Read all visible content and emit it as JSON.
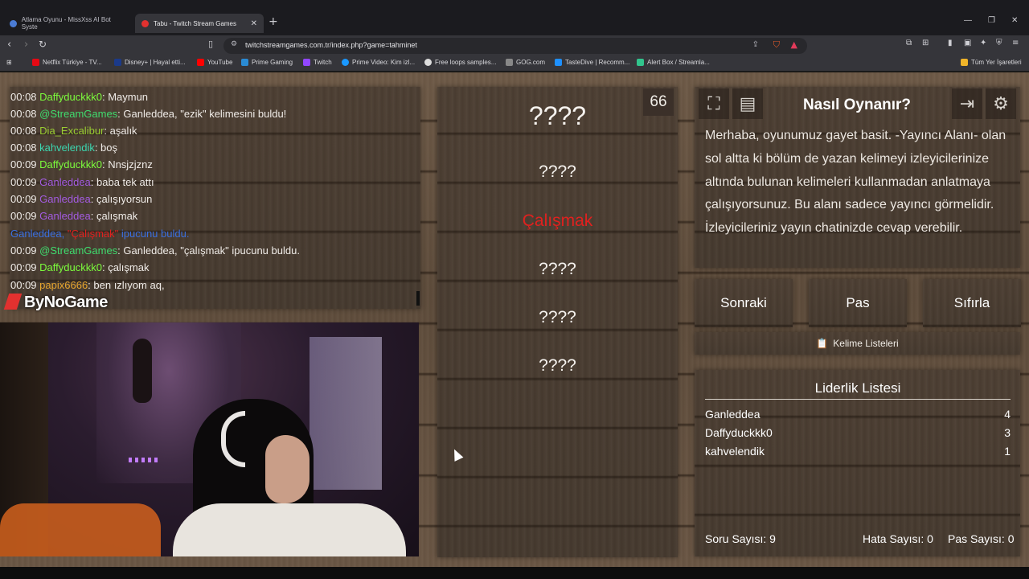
{
  "browser": {
    "tabs": [
      {
        "label": "Atlama Oyunu - MissXss AI Bot Syste",
        "active": false
      },
      {
        "label": "Tabu - Twitch Stream Games",
        "active": true
      }
    ],
    "url": "twitchstreamgames.com.tr/index.php?game=tahminet",
    "bookmarks": [
      "Netflix Türkiye - TV...",
      "Disney+ | Hayal etti...",
      "YouTube",
      "Prime Gaming",
      "Twitch",
      "Prime Video: Kim izl...",
      "Free loops samples...",
      "GOG.com",
      "TasteDive | Recomm...",
      "Alert Box / Streamla..."
    ],
    "bookmarks_other": "Tüm Yer İşaretleri"
  },
  "chat": {
    "lines": [
      {
        "time": "00:08",
        "user": "Daffyduckkk0",
        "user_color": "#7cfc3c",
        "text": ": Maymun"
      },
      {
        "time": "00:08",
        "user": "@StreamGames",
        "user_color": "#3fdc6e",
        "text": ": Ganleddea, \"ezik\" kelimesini buldu!"
      },
      {
        "time": "00:08",
        "user": "Dia_Excalibur",
        "user_color": "#9acd32",
        "text": ": aşalık"
      },
      {
        "time": "00:08",
        "user": "kahvelendik",
        "user_color": "#3cd6b0",
        "text": ": boş"
      },
      {
        "time": "00:09",
        "user": "Daffyduckkk0",
        "user_color": "#7cfc3c",
        "text": ": Nnsjzjznz"
      },
      {
        "time": "00:09",
        "user": "Ganleddea",
        "user_color": "#a35be0",
        "text": ": baba tek attı"
      },
      {
        "time": "00:09",
        "user": "Ganleddea",
        "user_color": "#a35be0",
        "text": ": çalışıyorsun"
      },
      {
        "time": "00:09",
        "user": "Ganleddea",
        "user_color": "#a35be0",
        "text": ": çalışmak"
      },
      {
        "time": "00:09",
        "user": "@StreamGames",
        "user_color": "#3fdc6e",
        "text": ": Ganleddea, \"çalışmak\" ipucunu buldu."
      },
      {
        "time": "00:09",
        "user": "Daffyduckkk0",
        "user_color": "#7cfc3c",
        "text": ": çalışmak"
      },
      {
        "time": "00:09",
        "user": "papix6666",
        "user_color": "#e6a52e",
        "text": ": ben ızlıyom aq,"
      }
    ],
    "system_line": {
      "user": "Ganleddea, ",
      "word": "\"Çalışmak\"",
      "rest": " ipucunu buldu."
    }
  },
  "logo": "ByNoGame",
  "game": {
    "timer": "66",
    "main_word": "????",
    "hints": [
      "????",
      "Çalışmak",
      "????",
      "????",
      "????"
    ],
    "found_color": "#e0211f"
  },
  "howto": {
    "title": "Nasıl Oynanır?",
    "text": "Merhaba, oyunumuz gayet basit. -Yayıncı Alanı- olan sol altta ki bölüm de yazan kelimeyi izleyicilerinize altında bulunan kelimeleri kullanmadan anlatmaya çalışıyorsunuz. Bu alanı sadece yayıncı görmelidir. İzleyicileriniz yayın chatinizde cevap verebilir.",
    "icons": [
      "fullscreen-icon",
      "document-icon",
      "exit-icon",
      "gear-icon"
    ]
  },
  "buttons": {
    "next": "Sonraki",
    "pass": "Pas",
    "reset": "Sıfırla",
    "word_lists": "Kelime Listeleri"
  },
  "leaderboard": {
    "title": "Liderlik Listesi",
    "rows": [
      {
        "name": "Ganleddea",
        "score": "4"
      },
      {
        "name": "Daffyduckkk0",
        "score": "3"
      },
      {
        "name": "kahvelendik",
        "score": "1"
      }
    ]
  },
  "stats": {
    "questions": "Soru Sayısı: 9",
    "errors": "Hata Sayısı: 0",
    "passes": "Pas Sayısı: 0"
  }
}
